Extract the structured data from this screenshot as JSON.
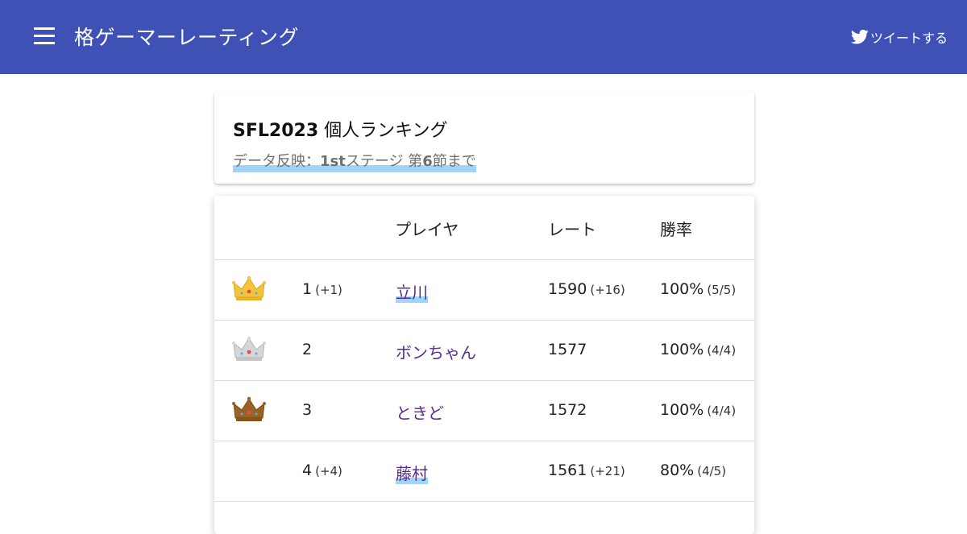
{
  "header": {
    "title": "格ゲーマーレーティング",
    "tweet_label": "ツイートする",
    "bg_color": "#3f51b5"
  },
  "summary": {
    "title_bold": "SFL2023",
    "title_rest": " 個人ランキング",
    "sub_prefix": "データ反映：",
    "sub_bold1": "1st",
    "sub_mid": "ステージ 第",
    "sub_bold2": "6",
    "sub_suffix": "節まで"
  },
  "table": {
    "headers": [
      "プレイヤ",
      "レート",
      "勝率"
    ],
    "rows": [
      {
        "crown": "gold-crown",
        "rank": "1",
        "rank_change": "(+1)",
        "player": "立川",
        "highlight": true,
        "rate": "1590",
        "rate_change": "(+16)",
        "win_pct": "100%",
        "record": "(5/5)"
      },
      {
        "crown": "silver-crown",
        "rank": "2",
        "rank_change": "",
        "player": "ボンちゃん",
        "highlight": false,
        "rate": "1577",
        "rate_change": "",
        "win_pct": "100%",
        "record": "(4/4)"
      },
      {
        "crown": "bronze-crown",
        "rank": "3",
        "rank_change": "",
        "player": "ときど",
        "highlight": false,
        "rate": "1572",
        "rate_change": "",
        "win_pct": "100%",
        "record": "(4/4)"
      },
      {
        "crown": "",
        "rank": "4",
        "rank_change": "(+4)",
        "player": "藤村",
        "highlight": true,
        "rate": "1561",
        "rate_change": "(+21)",
        "win_pct": "80%",
        "record": "(4/5)"
      }
    ]
  },
  "colors": {
    "link": "#5b2c8f",
    "highlight": "#9ed6f7",
    "gold": "#f3c33c",
    "silver": "#c9c9c9",
    "bronze": "#9a6224"
  }
}
